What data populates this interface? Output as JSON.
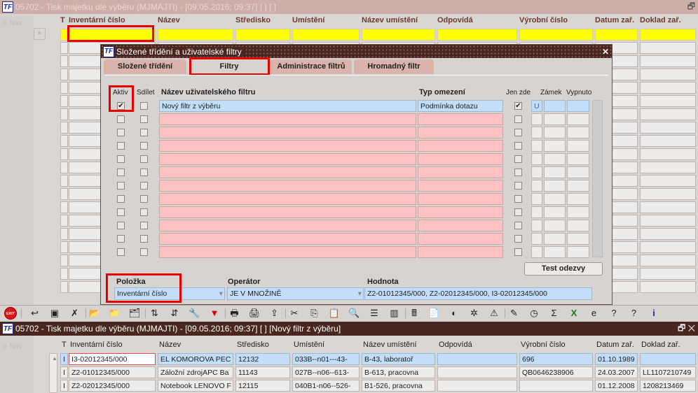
{
  "bg_window": {
    "title": "05702 - Tisk majetku dle výběru (MJMAJTI) - [09.05.2016; 09:37] [ ] [ ]",
    "nav": "Nav"
  },
  "columns": [
    "T",
    "Inventární číslo",
    "Název",
    "Středisko",
    "Umístění",
    "Název umístění",
    "Odpovídá",
    "Výrobní číslo",
    "Datum zař.",
    "Doklad zař."
  ],
  "dialog": {
    "title": "Složené třídění a uživatelské filtry",
    "tabs": [
      "Složené třídění",
      "Filtry",
      "Administrace filtrů",
      "Hromadný filtr"
    ],
    "headers": {
      "aktiv": "Aktiv",
      "sdilet": "Sdílet",
      "nazev": "Název uživatelského filtru",
      "typ": "Typ omezení",
      "jen_zde": "Jen zde",
      "zamek": "Zámek",
      "vypnuto": "Vypnuto"
    },
    "filters": [
      {
        "aktiv": true,
        "sdilet": false,
        "nazev": "Nový filtr z výběru",
        "typ": "Podmínka dotazu",
        "jen_zde": true,
        "zamek": "U",
        "vypnuto": ""
      }
    ],
    "empty_rows": 11,
    "test_button": "Test odezvy",
    "condition": {
      "polozka_label": "Položka",
      "operator_label": "Operátor",
      "hodnota_label": "Hodnota",
      "polozka": "Inventární číslo",
      "operator": "JE V MNOŽINĚ",
      "hodnota": "Z2-01012345/000, Z2-02012345/000, I3-02012345/000"
    }
  },
  "toolbar": {
    "exit_label": "EXIT",
    "icons": [
      "exit",
      "back",
      "new-record",
      "cancel",
      "folder-open",
      "folder-run",
      "folder-delete",
      "sort-asc",
      "sort-desc",
      "tools",
      "filter",
      "print",
      "print-preview",
      "export",
      "cut",
      "copy",
      "paste",
      "find",
      "list",
      "columns",
      "calculator",
      "document",
      "globe",
      "settings",
      "warning",
      "edit",
      "clock",
      "sum",
      "excel",
      "ie",
      "help",
      "context-help",
      "info"
    ]
  },
  "fg_window": {
    "title": "05702 - Tisk majetku dle výběru (MJMAJTI) - [09.05.2016; 09:37] [ ] [Nový filtr z výběru]",
    "nav": "Nav",
    "rows": [
      [
        "I",
        "I3-02012345/000",
        "EL KOMOROVA PEC",
        "12132",
        "033B--n01---43-",
        "B-43, laboratoř",
        "",
        "696",
        "01.10.1989",
        ""
      ],
      [
        "I",
        "Z2-01012345/000",
        "Záložní zdrojAPC Ba",
        "11143",
        "027B--n06--613-",
        "B-613, pracovna",
        "",
        "QB0646238906",
        "24.03.2007",
        "LL1107210749"
      ],
      [
        "I",
        "Z2-02012345/000",
        "Notebook LENOVO F",
        "12115",
        "040B1-n06--526-",
        "B1-526, pracovna",
        "",
        "",
        "01.12.2008",
        "1208213469"
      ]
    ]
  }
}
